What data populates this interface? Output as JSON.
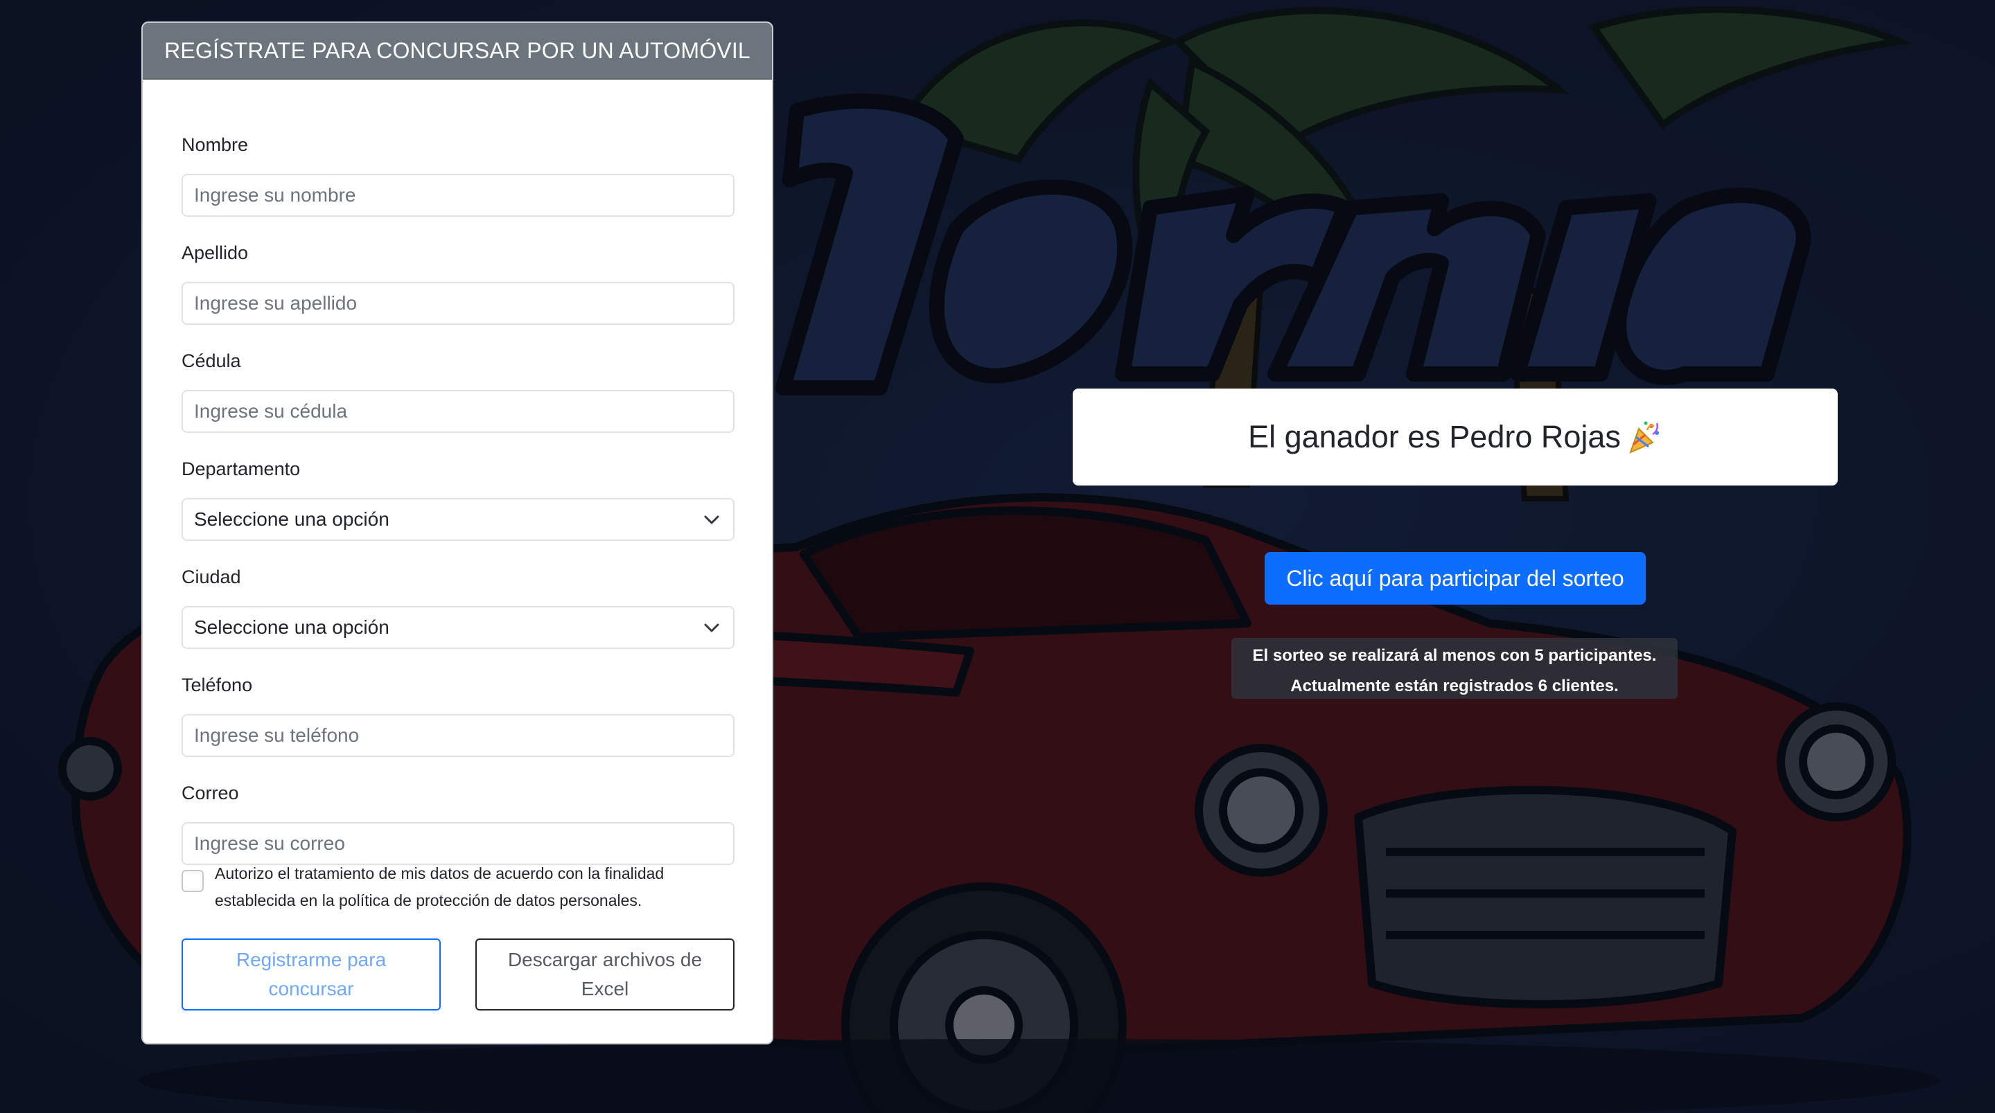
{
  "form": {
    "title": "REGÍSTRATE PARA CONCURSAR POR UN AUTOMÓVIL",
    "fields": [
      {
        "label": "Nombre",
        "placeholder": "Ingrese su nombre"
      },
      {
        "label": "Apellido",
        "placeholder": "Ingrese su apellido"
      },
      {
        "label": "Cédula",
        "placeholder": "Ingrese su cédula"
      },
      {
        "label": "Departamento",
        "selected": "Seleccione una opción"
      },
      {
        "label": "Ciudad",
        "selected": "Seleccione una opción"
      },
      {
        "label": "Teléfono",
        "placeholder": "Ingrese su teléfono"
      },
      {
        "label": "Correo",
        "placeholder": "Ingrese su correo"
      }
    ],
    "consent": "Autorizo el tratamiento de mis datos de acuerdo con la finalidad establecida en la política de protección de datos personales.",
    "consent_checked": false,
    "register_button": "Registrarme para concursar",
    "download_button": "Descargar archivos de Excel"
  },
  "winner": {
    "text": "El ganador es Pedro Rojas",
    "icon": "party-popper-icon"
  },
  "raffle": {
    "button": "Clic aquí para participar del sorteo",
    "info_line1": "El sorteo se realizará al menos con 5 participantes.",
    "info_line2": "Actualmente están registrados 6 clientes."
  },
  "colors": {
    "primary": "#0d6efd",
    "card_header": "#6c757d",
    "background": "#111a30"
  }
}
